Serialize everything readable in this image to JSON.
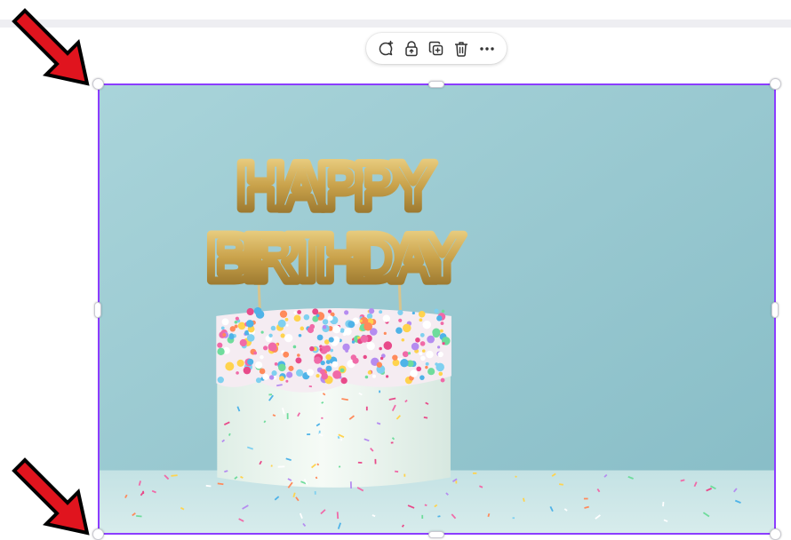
{
  "toolbar": {
    "buttons": [
      {
        "name": "comment-add",
        "icon": "comment-plus-icon"
      },
      {
        "name": "lock",
        "icon": "lock-icon"
      },
      {
        "name": "duplicate",
        "icon": "duplicate-icon"
      },
      {
        "name": "delete",
        "icon": "trash-icon"
      },
      {
        "name": "more",
        "icon": "more-dots-icon"
      }
    ]
  },
  "image": {
    "topper_line1": "HAPPY",
    "topper_line2": "BIRTHDAY",
    "selection_color": "#8b3dff"
  },
  "annotations": {
    "arrow_color": "#e0141e"
  }
}
